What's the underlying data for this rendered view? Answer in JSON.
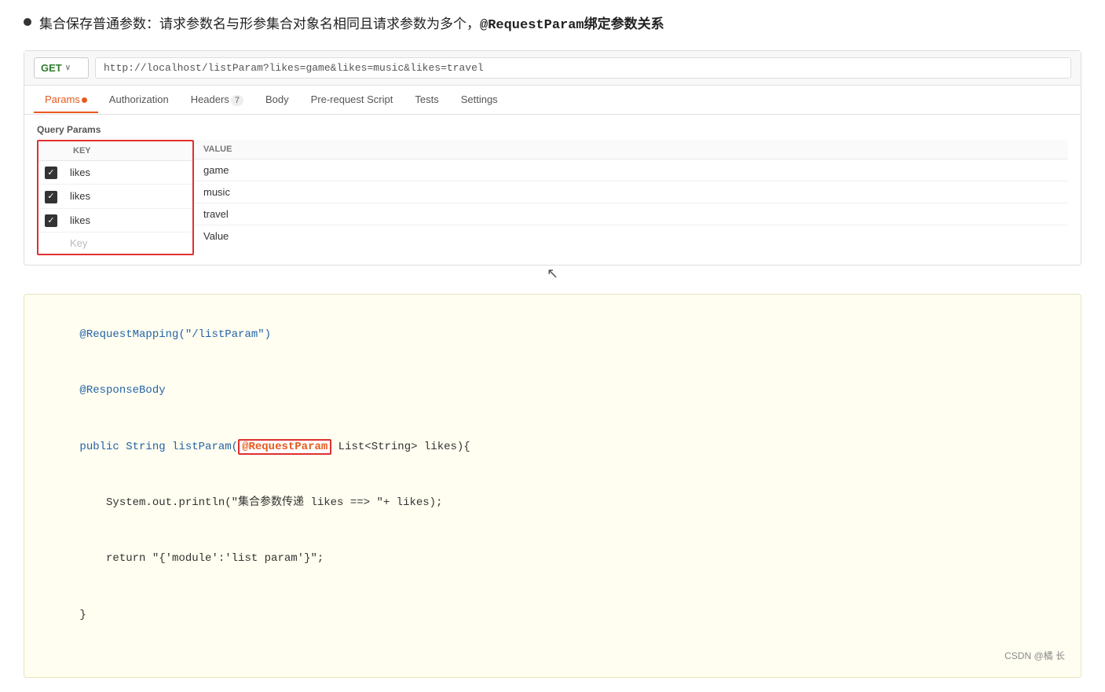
{
  "page": {
    "bullet_text": "集合保存普通参数：请求参数名与形参集合对象名相同且请求参数为多个，",
    "bullet_text2": "@RequestParam绑定参数关系"
  },
  "url_bar": {
    "method": "GET",
    "url": "http://localhost/listParam?likes=game&likes=music&likes=travel",
    "chevron": "∨"
  },
  "tabs": [
    {
      "label": "Params",
      "active": true,
      "has_dot": true
    },
    {
      "label": "Authorization",
      "active": false
    },
    {
      "label": "Headers",
      "badge": "7",
      "active": false
    },
    {
      "label": "Body",
      "active": false
    },
    {
      "label": "Pre-request Script",
      "active": false
    },
    {
      "label": "Tests",
      "active": false
    },
    {
      "label": "Settings",
      "active": false
    }
  ],
  "query_params": {
    "section_label": "Query Params",
    "columns": {
      "key": "KEY",
      "value": "VALUE"
    },
    "rows": [
      {
        "checked": true,
        "key": "likes",
        "value": "game"
      },
      {
        "checked": true,
        "key": "likes",
        "value": "music"
      },
      {
        "checked": true,
        "key": "likes",
        "value": "travel"
      },
      {
        "checked": false,
        "key": "Key",
        "value": "Value",
        "is_placeholder": true
      }
    ]
  },
  "code": {
    "line1": "@RequestMapping(\"/listParam\")",
    "line2": "@ResponseBody",
    "line3_pre": "public String listParam(",
    "line3_highlight": "@RequestParam",
    "line3_post": " List<String> likes){",
    "line4": "    System.out.println(\"集合参数传递 likes ==> \"+ likes);",
    "line5": "    return \"{'module':'list param'}\";",
    "line6": "}",
    "annotation": "CSDN @橘 长"
  }
}
